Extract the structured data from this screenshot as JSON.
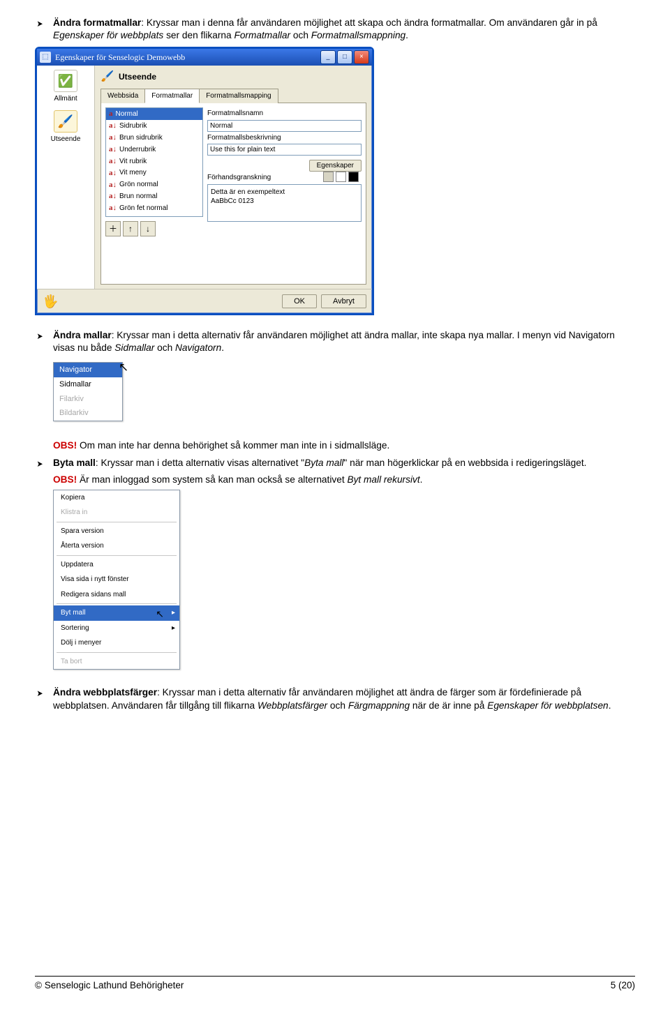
{
  "bullets": {
    "b1_title": "Ändra formatmallar",
    "b1_text": ": Kryssar man i denna får användaren möjlighet att skapa och ändra formatmallar. Om användaren går in på ",
    "b1_i1": "Egenskaper för webbplats",
    "b1_text2": " ser den flikarna ",
    "b1_i2": "Formatmallar",
    "b1_text3": " och ",
    "b1_i3": "Formatmallsmappning",
    "b1_end": ".",
    "b2_title": "Ändra mallar",
    "b2_text": ": Kryssar man i detta alternativ får användaren möjlighet att ändra mallar, inte skapa nya mallar. I menyn vid Navigatorn visas nu både ",
    "b2_i1": "Sidmallar",
    "b2_text2": " och ",
    "b2_i2": "Navigatorn",
    "b2_end": ".",
    "b3_title": "Byta mall",
    "b3_text": ": Kryssar man i detta alternativ visas alternativet \"",
    "b3_i1": "Byta mall",
    "b3_text2": "\" när man högerklickar på en webbsida i redigeringsläget.",
    "b4_title": "Ändra webbplatsfärger",
    "b4_text": ": Kryssar man i detta alternativ får användaren möjlighet att ändra de färger som är fördefinierade på webbplatsen. Användaren får tillgång till flikarna ",
    "b4_i1": "Webbplatsfärger",
    "b4_text2": " och ",
    "b4_i2": "Färgmappning",
    "b4_text3": " när de är inne på ",
    "b4_i3": "Egenskaper för webbplatsen",
    "b4_end": "."
  },
  "obs": {
    "label": "OBS!",
    "line1": " Om man inte har denna behörighet så kommer man inte in i sidmallsläge.",
    "line2_a": " Är man inloggad som system så kan man också se alternativet ",
    "line2_i": "Byt mall rekursivt",
    "line2_b": "."
  },
  "win1": {
    "title": "Egenskaper för Senselogic Demowebb",
    "btn_min": "_",
    "btn_max": "□",
    "btn_close": "×",
    "side_allmant": "Allmänt",
    "side_utseende": "Utseende",
    "main_heading": "Utseende",
    "tabs": [
      "Webbsida",
      "Formatmallar",
      "Formatmallsmapping"
    ],
    "styles": [
      "Normal",
      "Sidrubrik",
      "Brun sidrubrik",
      "Underrubrik",
      "Vit rubrik",
      "Vit meny",
      "Grön normal",
      "Brun normal",
      "Grön fet normal"
    ],
    "lbl_name": "Formatmallsnamn",
    "val_name": "Normal",
    "lbl_desc": "Formatmallsbeskrivning",
    "val_desc": "Use this for plain text",
    "btn_props": "Egenskaper",
    "lbl_preview": "Förhandsgranskning",
    "preview_l1": "Detta är en exempeltext",
    "preview_l2": "AaBbCc 0123",
    "btn_add": "＋",
    "btn_up": "↑",
    "btn_down": "↓",
    "btn_ok": "OK",
    "btn_cancel": "Avbryt"
  },
  "menu1": {
    "items": [
      {
        "label": "Navigator",
        "sel": true
      },
      {
        "label": "Sidmallar"
      },
      {
        "label": "Filarkiv",
        "dis": true
      },
      {
        "label": "Bildarkiv",
        "dis": true
      }
    ]
  },
  "menu2": {
    "groups": [
      [
        {
          "label": "Kopiera"
        },
        {
          "label": "Klistra in",
          "dis": true
        }
      ],
      [
        {
          "label": "Spara version"
        },
        {
          "label": "Återta version"
        }
      ],
      [
        {
          "label": "Uppdatera"
        },
        {
          "label": "Visa sida i nytt fönster"
        },
        {
          "label": "Redigera sidans mall"
        }
      ],
      [
        {
          "label": "Byt mall",
          "sel": true,
          "arrow": true
        },
        {
          "label": "Sortering",
          "arrow": true
        },
        {
          "label": "Dölj i menyer"
        }
      ],
      [
        {
          "label": "Ta bort",
          "dis": true
        }
      ]
    ]
  },
  "footer": {
    "left": "© Senselogic Lathund Behörigheter",
    "right": "5 (20)"
  }
}
